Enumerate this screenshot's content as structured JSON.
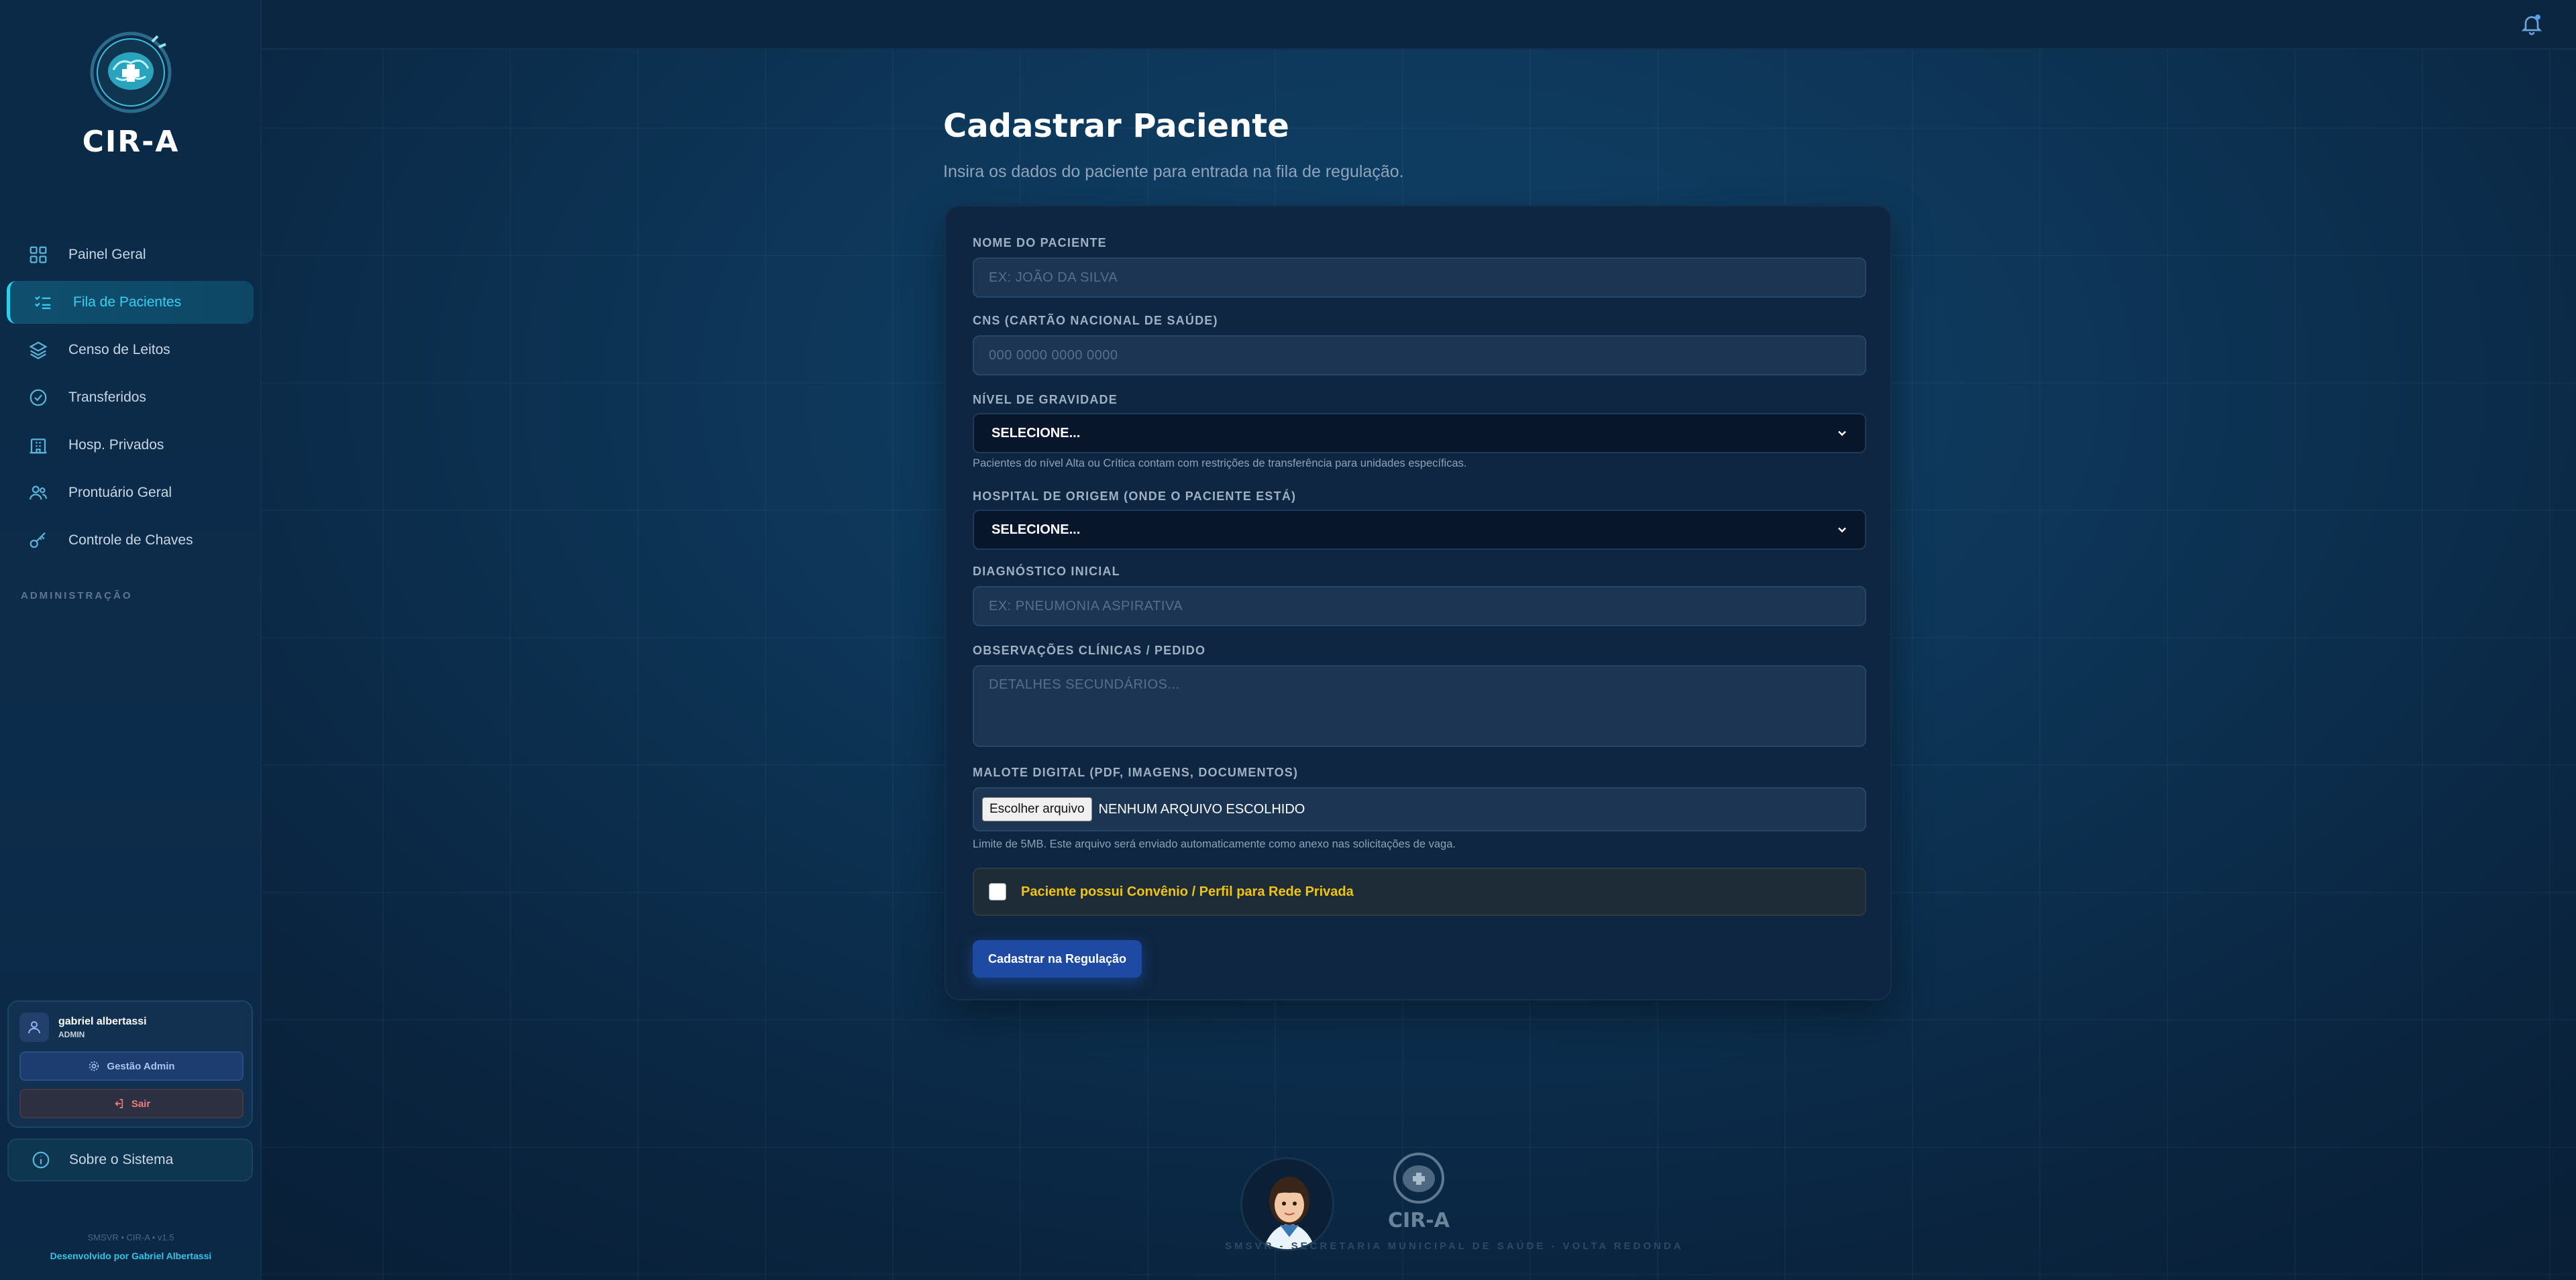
{
  "app": {
    "logo_text": "CIR-A"
  },
  "sidebar": {
    "items": [
      {
        "label": "Painel Geral"
      },
      {
        "label": "Fila de Pacientes"
      },
      {
        "label": "Censo de Leitos"
      },
      {
        "label": "Transferidos"
      },
      {
        "label": "Hosp. Privados"
      },
      {
        "label": "Prontuário Geral"
      },
      {
        "label": "Controle de Chaves"
      }
    ],
    "section_label": "ADMINISTRAÇÃO",
    "user": {
      "name": "gabriel albertassi",
      "role": "ADMIN"
    },
    "admin_button": "Gestão Admin",
    "exit_button": "Sair",
    "about": "Sobre o Sistema",
    "version": "SMSVR • CIR-A • v1.5",
    "developer": "Desenvolvido por Gabriel Albertassi"
  },
  "page": {
    "title": "Cadastrar Paciente",
    "subtitle": "Insira os dados do paciente para entrada na fila de regulação."
  },
  "form": {
    "nome_label": "NOME DO PACIENTE",
    "nome_placeholder": "EX: JOÃO DA SILVA",
    "cns_label": "CNS (CARTÃO NACIONAL DE SAÚDE)",
    "cns_placeholder": "000 0000 0000 0000",
    "gravidade_label": "NÍVEL DE GRAVIDADE",
    "gravidade_value": "SELECIONE...",
    "gravidade_hint": "Pacientes do nível Alta ou Crítica contam com restrições de transferência para unidades específicas.",
    "hospital_label": "HOSPITAL DE ORIGEM (ONDE O PACIENTE ESTÁ)",
    "hospital_value": "SELECIONE...",
    "diagnostico_label": "DIAGNÓSTICO INICIAL",
    "diagnostico_placeholder": "EX: PNEUMONIA ASPIRATIVA",
    "obs_label": "OBSERVAÇÕES CLÍNICAS / PEDIDO",
    "obs_placeholder": "DETALHES SECUNDÁRIOS...",
    "malote_label": "MALOTE DIGITAL (PDF, IMAGENS, DOCUMENTOS)",
    "file_button": "Escolher arquivo",
    "file_status": "NENHUM ARQUIVO ESCOLHIDO",
    "malote_hint": "Limite de 5MB. Este arquivo será enviado automaticamente como anexo nas solicitações de vaga.",
    "convenio_label": "Paciente possui Convênio / Perfil para Rede Privada",
    "submit": "Cadastrar na Regulação"
  },
  "footer": {
    "logo_text": "CIR-A",
    "org": "SMSVR - SECRETARIA MUNICIPAL DE SAÚDE - VOLTA REDONDA"
  },
  "colors": {
    "accent": "#2bd0f0",
    "primary_button": "#1f4aa3",
    "warning_text": "#f1c40f"
  }
}
